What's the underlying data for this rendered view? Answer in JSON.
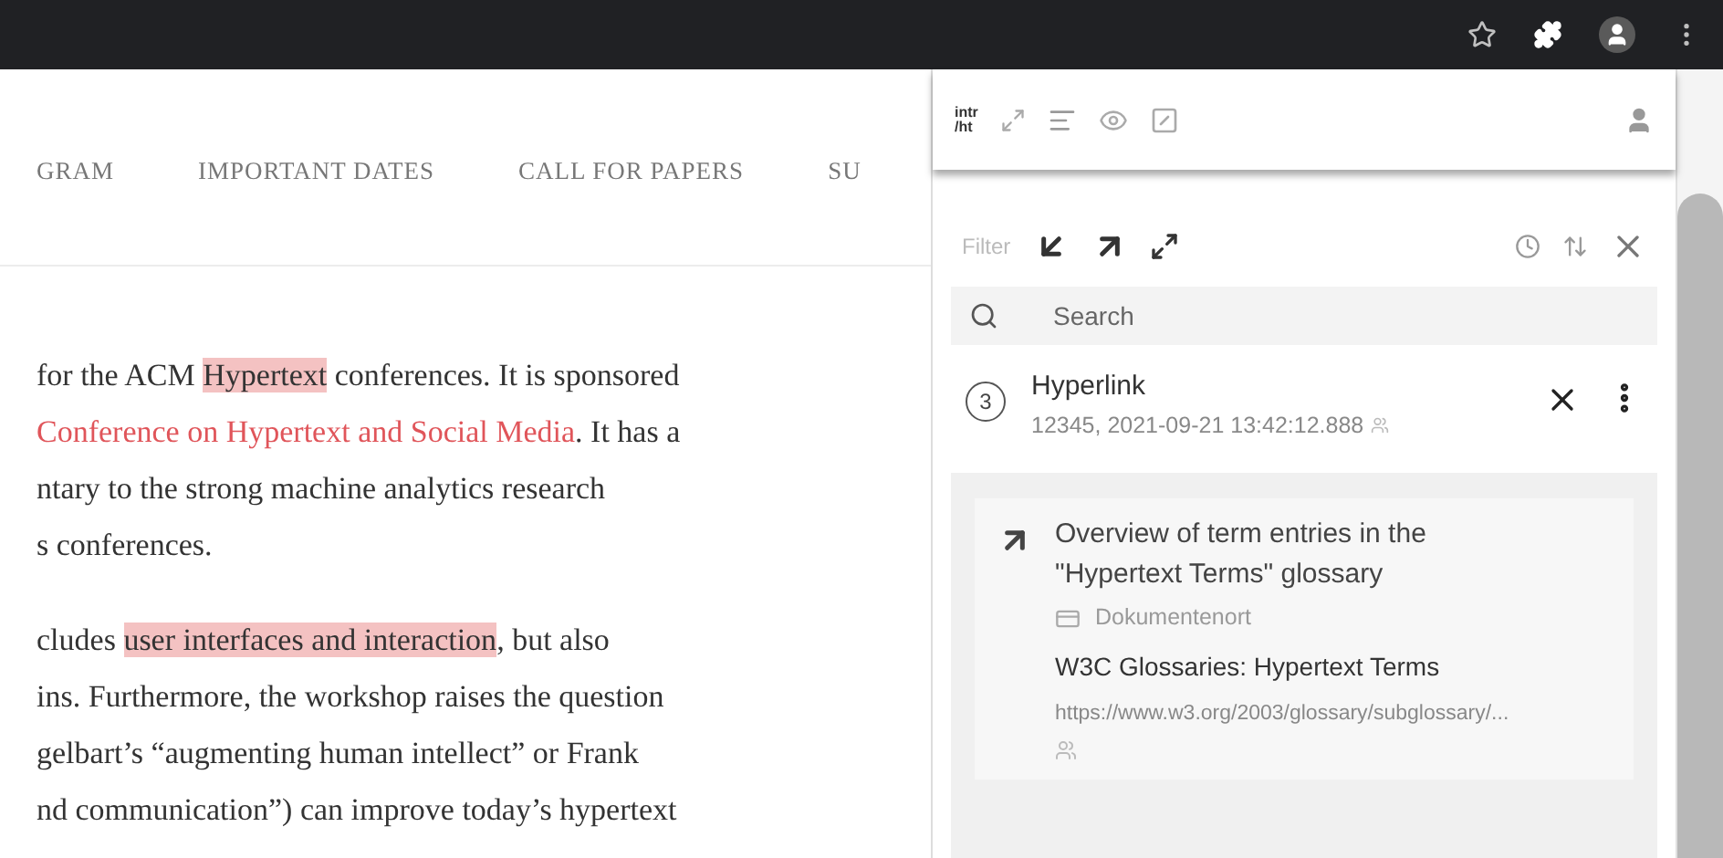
{
  "nav": [
    "GRAM",
    "IMPORTANT DATES",
    "CALL FOR PAPERS",
    "SU"
  ],
  "paragraphs": [
    [
      [
        {
          "kind": "plain",
          "text": "for the ACM "
        },
        {
          "kind": "highlight",
          "text": "Hypertext"
        },
        {
          "kind": "plain",
          "text": " conferences. It is sponsored"
        }
      ],
      [
        {
          "kind": "link",
          "text": "Conference on Hypertext and Social Media"
        },
        {
          "kind": "plain",
          "text": ". It has a"
        }
      ],
      [
        {
          "kind": "plain",
          "text": "ntary to the strong machine analytics research"
        }
      ],
      [
        {
          "kind": "plain",
          "text": "s conferences."
        }
      ]
    ],
    [
      [
        {
          "kind": "plain",
          "text": "cludes "
        },
        {
          "kind": "highlight",
          "text": "user interfaces and interaction"
        },
        {
          "kind": "plain",
          "text": ", but also"
        }
      ],
      [
        {
          "kind": "plain",
          "text": "ins. Furthermore, the workshop raises the question"
        }
      ],
      [
        {
          "kind": "plain",
          "text": "gelbart’s “augmenting human intellect” or Frank"
        }
      ],
      [
        {
          "kind": "plain",
          "text": "nd communication”) can improve today’s hypertext"
        }
      ]
    ]
  ],
  "panel": {
    "logo": [
      "intr",
      "/ht"
    ],
    "filter_label": "Filter",
    "search": {
      "placeholder": "Search"
    },
    "entry": {
      "count": "3",
      "title": "Hyperlink",
      "meta": "12345, 2021-09-21 13:42:12.888"
    },
    "card": {
      "title": "Overview of term entries in the \"Hypertext Terms\" glossary",
      "location": "Dokumentenort",
      "source": "W3C Glossaries: Hypertext Terms",
      "url": "https://www.w3.org/2003/glossary/subglossary/..."
    }
  }
}
